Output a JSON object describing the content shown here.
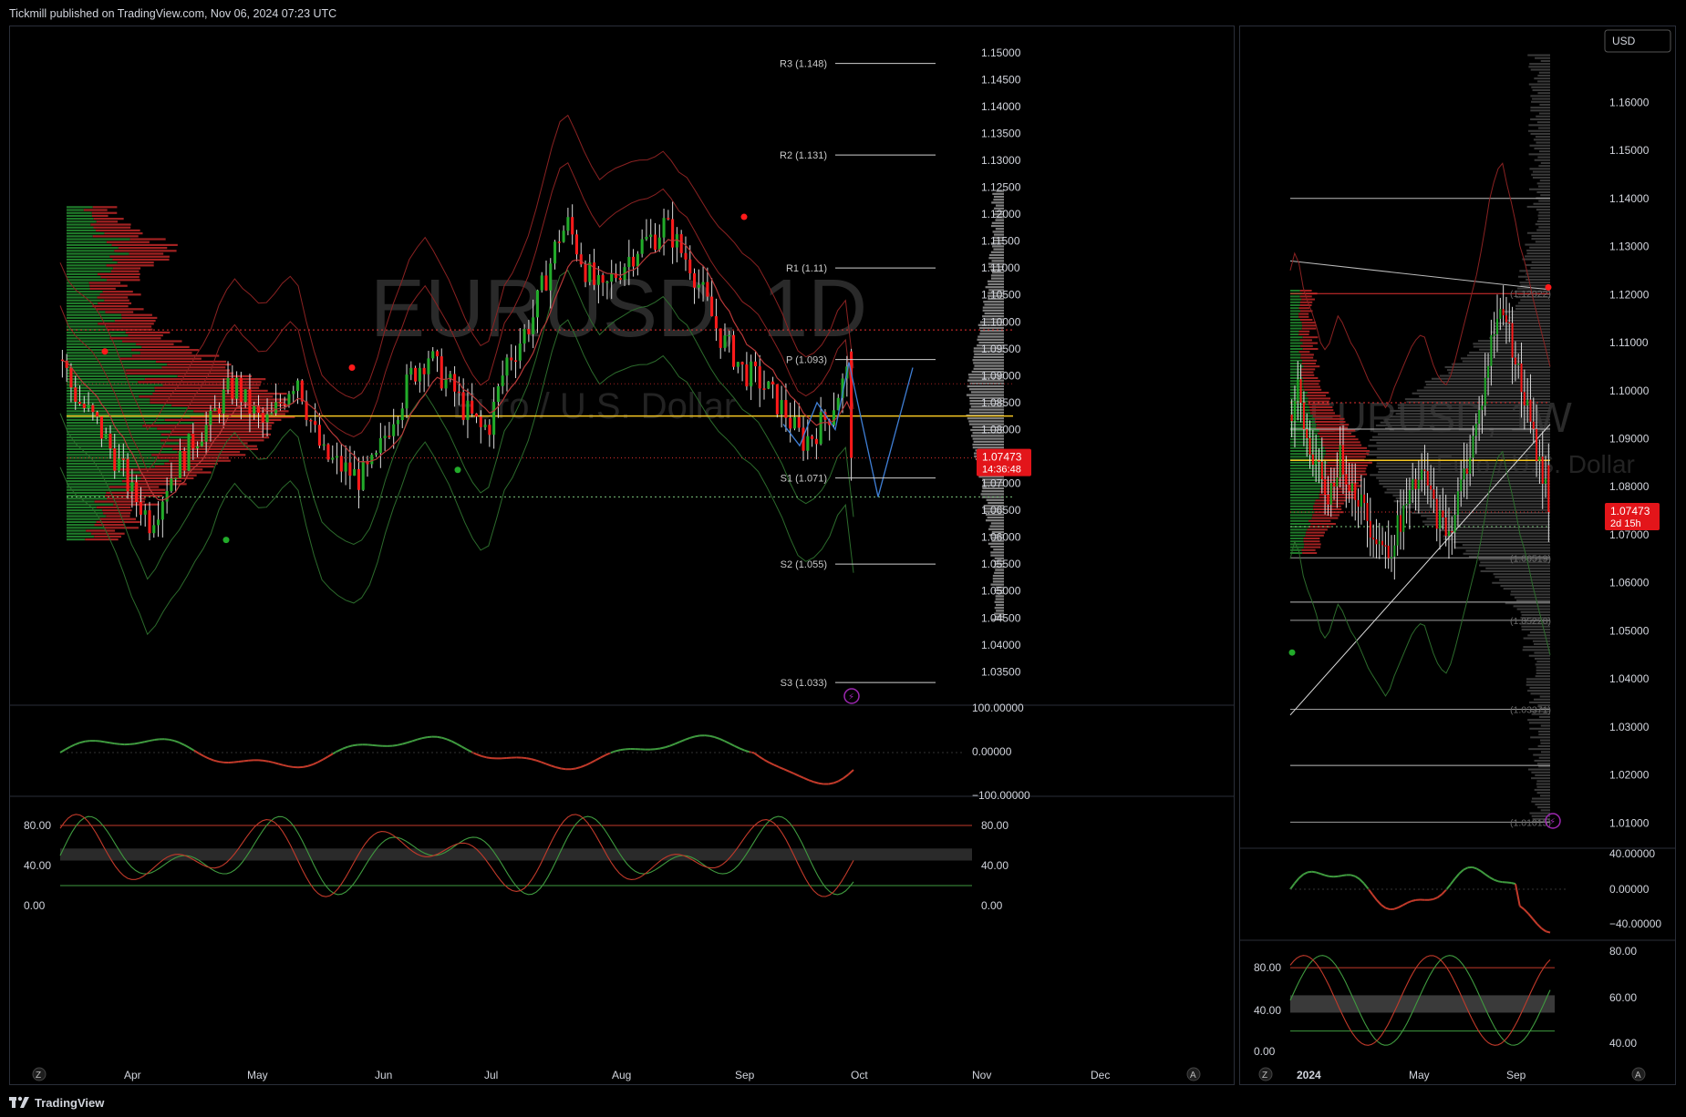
{
  "header": {
    "published": "Tickmill published on TradingView.com, Nov 06, 2024 07:23 UTC"
  },
  "footer": {
    "brand": "TradingView"
  },
  "colors": {
    "up": "#22ab2a",
    "down": "#ff1a1a",
    "poc": "#f5c623",
    "pivot": "#cfcfcf",
    "projection": "#3f7fd6",
    "label_bg": "#e3151a"
  },
  "left": {
    "watermark_symbol": "EURUSD, 1D",
    "watermark_name": "Euro / U.S. Dollar",
    "price_ticks": [
      "1.15000",
      "1.14500",
      "1.14000",
      "1.13500",
      "1.13000",
      "1.12500",
      "1.12000",
      "1.11500",
      "1.11000",
      "1.10500",
      "1.10000",
      "1.09500",
      "1.09000",
      "1.08500",
      "1.08000",
      "1.07500",
      "1.07000",
      "1.06500",
      "1.06000",
      "1.05500",
      "1.05000",
      "1.04500",
      "1.04000",
      "1.03500"
    ],
    "current_price": "1.07473",
    "countdown": "14:36:48",
    "pivots": [
      {
        "label": "R3 (1.148)",
        "price": 1.148
      },
      {
        "label": "R2 (1.131)",
        "price": 1.131
      },
      {
        "label": "R1 (1.11)",
        "price": 1.11
      },
      {
        "label": "P (1.093)",
        "price": 1.093
      },
      {
        "label": "S1 (1.071)",
        "price": 1.071
      },
      {
        "label": "S2 (1.055)",
        "price": 1.055
      },
      {
        "label": "S3 (1.033)",
        "price": 1.033
      }
    ],
    "months": [
      "Apr",
      "May",
      "Jun",
      "Jul",
      "Aug",
      "Sep",
      "Oct",
      "Nov",
      "Dec"
    ],
    "osc1_ticks": [
      "100.00000",
      "0.00000",
      "−100.00000"
    ],
    "osc2_ticks_left": [
      "80.00",
      "40.00",
      "0.00"
    ],
    "osc2_ticks_right": [
      "80.00",
      "40.00",
      "0.00"
    ],
    "corner_z": "Z",
    "corner_a": "A"
  },
  "right": {
    "watermark_symbol": "EURUSD, 1W",
    "watermark_name": "Euro / U.S. Dollar",
    "currency": "USD",
    "price_ticks": [
      "1.16000",
      "1.15000",
      "1.14000",
      "1.13000",
      "1.12000",
      "1.11000",
      "1.10000",
      "1.09000",
      "1.08000",
      "1.07000",
      "1.06000",
      "1.05000",
      "1.04000",
      "1.03000",
      "1.02000",
      "1.01000"
    ],
    "current_price": "1.07473",
    "countdown": "2d 15h",
    "fib_labels": [
      {
        "label": "(1.12022)",
        "price": 1.1202
      },
      {
        "label": "(1.06519)",
        "price": 1.0652
      },
      {
        "label": "(1.05220)",
        "price": 1.0522
      },
      {
        "label": "(1.03371)",
        "price": 1.0337
      },
      {
        "label": "(1.01015)",
        "price": 1.0102
      }
    ],
    "months": [
      "2024",
      "May",
      "Sep"
    ],
    "osc1_ticks": [
      "40.00000",
      "0.00000",
      "−40.00000"
    ],
    "osc2_ticks_left": [
      "80.00",
      "40.00",
      "0.00"
    ],
    "osc2_ticks_right": [
      "80.00",
      "60.00",
      "40.00"
    ],
    "corner_z": "Z",
    "corner_a": "A"
  },
  "chart_data": [
    {
      "type": "candlestick",
      "title": "EURUSD, 1D",
      "subtitle": "Euro / U.S. Dollar",
      "ylim": [
        1.031,
        1.152
      ],
      "x": [
        "Apr",
        "May",
        "Jun",
        "Jul",
        "Aug",
        "Sep",
        "Oct",
        "Nov",
        "Dec"
      ],
      "close_path": [
        1.093,
        1.088,
        1.085,
        1.083,
        1.081,
        1.078,
        1.075,
        1.072,
        1.068,
        1.066,
        1.063,
        1.066,
        1.07,
        1.073,
        1.075,
        1.078,
        1.08,
        1.081,
        1.085,
        1.087,
        1.088,
        1.085,
        1.083,
        1.081,
        1.082,
        1.085,
        1.088,
        1.09,
        1.084,
        1.079,
        1.075,
        1.074,
        1.073,
        1.072,
        1.071,
        1.072,
        1.074,
        1.079,
        1.083,
        1.086,
        1.09,
        1.092,
        1.094,
        1.091,
        1.089,
        1.087,
        1.084,
        1.082,
        1.08,
        1.081,
        1.087,
        1.093,
        1.095,
        1.098,
        1.101,
        1.106,
        1.111,
        1.116,
        1.118,
        1.114,
        1.11,
        1.107,
        1.105,
        1.108,
        1.11,
        1.112,
        1.114,
        1.115,
        1.116,
        1.118,
        1.116,
        1.113,
        1.111,
        1.107,
        1.103,
        1.099,
        1.096,
        1.094,
        1.091,
        1.09,
        1.089,
        1.087,
        1.085,
        1.083,
        1.08,
        1.078,
        1.079,
        1.081,
        1.083,
        1.087,
        1.09,
        1.075
      ],
      "pivots": {
        "R3": 1.148,
        "R2": 1.131,
        "R1": 1.11,
        "P": 1.093,
        "S1": 1.071,
        "S2": 1.055,
        "S3": 1.033
      },
      "poc": 1.0825,
      "value_area_high": 1.0985,
      "value_area_low": 1.0675,
      "current": 1.07473
    },
    {
      "type": "candlestick",
      "title": "EURUSD, 1W",
      "subtitle": "Euro / U.S. Dollar",
      "ylim": [
        1.008,
        1.172
      ],
      "x": [
        "2024",
        "May",
        "Sep"
      ],
      "close_path": [
        1.095,
        1.1,
        1.092,
        1.088,
        1.085,
        1.08,
        1.078,
        1.082,
        1.086,
        1.083,
        1.08,
        1.078,
        1.075,
        1.072,
        1.07,
        1.068,
        1.066,
        1.07,
        1.073,
        1.076,
        1.079,
        1.081,
        1.082,
        1.078,
        1.074,
        1.072,
        1.071,
        1.075,
        1.08,
        1.085,
        1.09,
        1.095,
        1.102,
        1.11,
        1.115,
        1.118,
        1.112,
        1.107,
        1.1,
        1.096,
        1.09,
        1.085,
        1.08,
        1.075
      ],
      "poc": 1.0855,
      "current": 1.07473
    }
  ]
}
